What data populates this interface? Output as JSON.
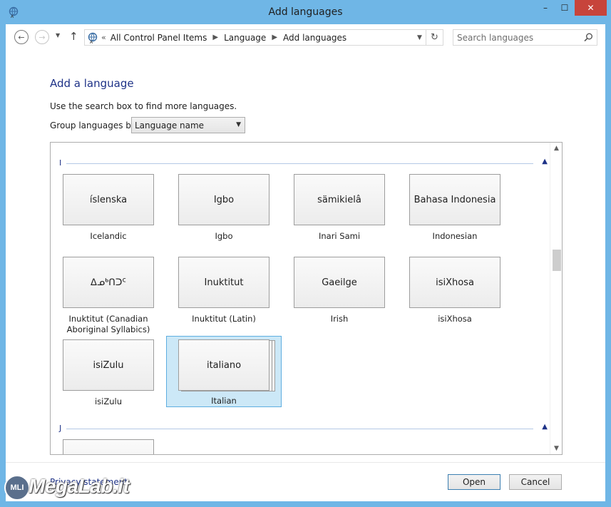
{
  "window": {
    "title": "Add languages",
    "controls": {
      "minimize": "–",
      "maximize": "☐",
      "close": "✕"
    }
  },
  "nav": {
    "back_icon": "arrow-left-icon",
    "forward_icon": "arrow-right-icon",
    "recent_icon": "chevron-down-icon",
    "up_icon": "arrow-up-icon",
    "breadcrumb": [
      "All Control Panel Items",
      "Language",
      "Add languages"
    ],
    "address_prefix": "«",
    "search_placeholder": "Search languages"
  },
  "content": {
    "heading": "Add a language",
    "hint": "Use the search box to find more languages.",
    "group_by_label": "Group languages by:",
    "group_by_value": "Language name"
  },
  "groups": [
    {
      "letter": "I",
      "languages": [
        {
          "native": "íslenska",
          "english": "Icelandic"
        },
        {
          "native": "Igbo",
          "english": "Igbo"
        },
        {
          "native": "sämikielâ",
          "english": "Inari Sami"
        },
        {
          "native": "Bahasa Indonesia",
          "english": "Indonesian"
        },
        {
          "native": "ᐃᓄᒃᑎᑐᑦ",
          "english": "Inuktitut (Canadian Aboriginal Syllabics)"
        },
        {
          "native": "Inuktitut",
          "english": "Inuktitut (Latin)"
        },
        {
          "native": "Gaeilge",
          "english": "Irish"
        },
        {
          "native": "isiXhosa",
          "english": "isiXhosa"
        },
        {
          "native": "isiZulu",
          "english": "isiZulu"
        },
        {
          "native": "italiano",
          "english": "Italian",
          "selected": true
        }
      ]
    },
    {
      "letter": "J",
      "languages": []
    }
  ],
  "footer": {
    "privacy_link": "Privacy statement",
    "open_button": "Open",
    "cancel_button": "Cancel"
  },
  "watermark": {
    "badge": "MLI",
    "text": "MegaLab.it"
  },
  "colors": {
    "frame": "#6fb6e6",
    "heading": "#1e3287",
    "close_button": "#c7443b",
    "selection_fill": "#cce8f7",
    "selection_border": "#5eaee0"
  }
}
